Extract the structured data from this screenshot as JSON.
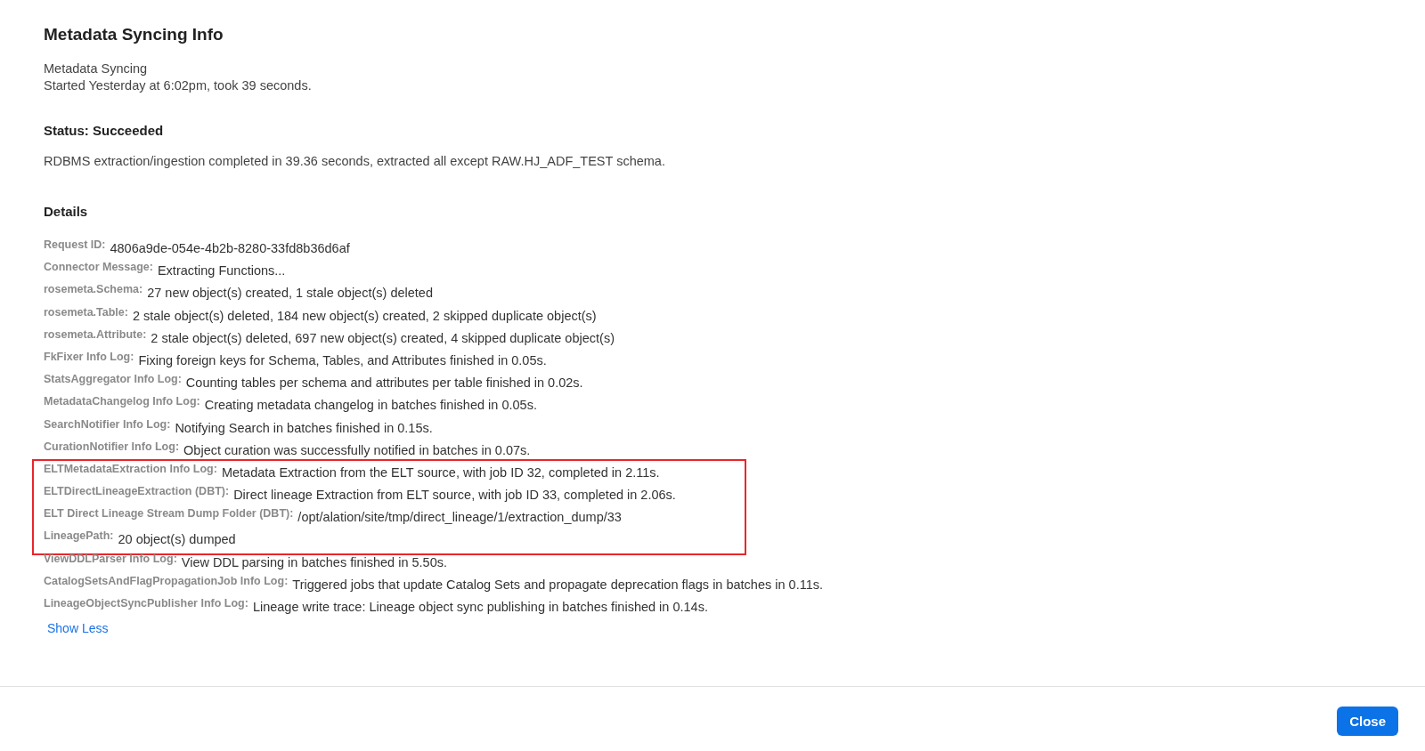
{
  "dialog": {
    "title": "Metadata Syncing Info",
    "job_name": "Metadata Syncing",
    "job_timing": "Started Yesterday at 6:02pm, took 39 seconds.",
    "status_heading": "Status: Succeeded",
    "status_message": "RDBMS extraction/ingestion completed in 39.36 seconds, extracted all except RAW.HJ_ADF_TEST schema.",
    "details_heading": "Details",
    "details": [
      {
        "label": "Request ID:",
        "value": "4806a9de-054e-4b2b-8280-33fd8b36d6af",
        "highlighted": false
      },
      {
        "label": "Connector Message:",
        "value": "Extracting Functions...",
        "highlighted": false
      },
      {
        "label": "rosemeta.Schema:",
        "value": "27 new object(s) created, 1 stale object(s) deleted",
        "highlighted": false
      },
      {
        "label": "rosemeta.Table:",
        "value": "2 stale object(s) deleted, 184 new object(s) created, 2 skipped duplicate object(s)",
        "highlighted": false
      },
      {
        "label": "rosemeta.Attribute:",
        "value": "2 stale object(s) deleted, 697 new object(s) created, 4 skipped duplicate object(s)",
        "highlighted": false
      },
      {
        "label": "FkFixer Info Log:",
        "value": "Fixing foreign keys for Schema, Tables, and Attributes finished in 0.05s.",
        "highlighted": false
      },
      {
        "label": "StatsAggregator Info Log:",
        "value": "Counting tables per schema and attributes per table finished in 0.02s.",
        "highlighted": false
      },
      {
        "label": "MetadataChangelog Info Log:",
        "value": "Creating metadata changelog in batches finished in 0.05s.",
        "highlighted": false
      },
      {
        "label": "SearchNotifier Info Log:",
        "value": "Notifying Search in batches finished in 0.15s.",
        "highlighted": false
      },
      {
        "label": "CurationNotifier Info Log:",
        "value": "Object curation was successfully notified in batches in 0.07s.",
        "highlighted": false
      },
      {
        "label": "ELTMetadataExtraction Info Log:",
        "value": "Metadata Extraction from the ELT source, with job ID 32, completed in 2.11s.",
        "highlighted": true
      },
      {
        "label": "ELTDirectLineageExtraction (DBT):",
        "value": "Direct lineage Extraction from ELT source, with job ID 33, completed in 2.06s.",
        "highlighted": true
      },
      {
        "label": "ELT Direct Lineage Stream Dump Folder (DBT):",
        "value": "/opt/alation/site/tmp/direct_lineage/1/extraction_dump/33",
        "highlighted": true
      },
      {
        "label": "LineagePath:",
        "value": "20 object(s) dumped",
        "highlighted": true
      },
      {
        "label": "ViewDDLParser Info Log:",
        "value": "View DDL parsing in batches finished in 5.50s.",
        "highlighted": false
      },
      {
        "label": "CatalogSetsAndFlagPropagationJob Info Log:",
        "value": "Triggered jobs that update Catalog Sets and propagate deprecation flags in batches in 0.11s.",
        "highlighted": false
      },
      {
        "label": "LineageObjectSyncPublisher Info Log:",
        "value": "Lineage write trace: Lineage object sync publishing in batches finished in 0.14s.",
        "highlighted": false
      }
    ],
    "toggle_link": "Show Less",
    "close_button": "Close"
  }
}
